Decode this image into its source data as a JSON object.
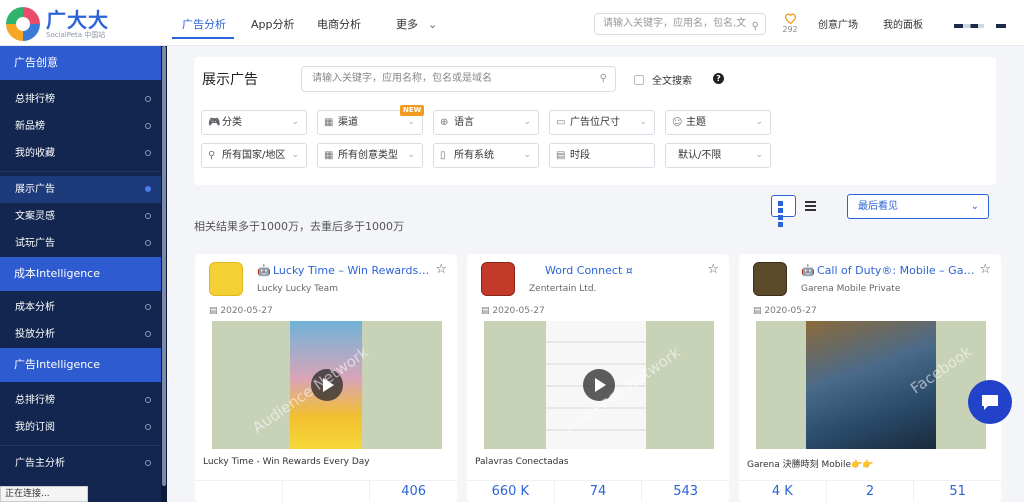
{
  "brand": {
    "name": "广大大",
    "sub": "SocialPeta 中国站"
  },
  "topnav": {
    "tabs": [
      "广告分析",
      "App分析",
      "电商分析",
      "更多"
    ],
    "active": 0
  },
  "top_search": {
    "placeholder": "请输入关键字，应用名，包名,文"
  },
  "favorites": {
    "count": "292"
  },
  "right_links": [
    "创意广场",
    "我的面板"
  ],
  "sidebar": {
    "sections": [
      {
        "title": "广告创意",
        "items": [
          {
            "label": "总排行榜"
          },
          {
            "label": "新品榜"
          },
          {
            "label": "我的收藏"
          },
          {
            "label": "展示广告",
            "active": true
          },
          {
            "label": "文案灵感"
          },
          {
            "label": "试玩广告"
          }
        ]
      },
      {
        "title": "成本Intelligence",
        "items": [
          {
            "label": "成本分析"
          },
          {
            "label": "投放分析"
          }
        ]
      },
      {
        "title": "广告Intelligence",
        "items": [
          {
            "label": "总排行榜"
          },
          {
            "label": "我的订阅"
          },
          {
            "label": "广告主分析"
          }
        ]
      }
    ]
  },
  "panel": {
    "title": "展示广告",
    "search_placeholder": "请输入关键字，应用名称，包名或是域名",
    "fulltext_label": "全文搜索",
    "help": "?",
    "filters_row1": [
      {
        "label": "分类",
        "icon": "gamepad-icon"
      },
      {
        "label": "渠道",
        "icon": "grid-icon",
        "badge": "NEW"
      },
      {
        "label": "语言",
        "icon": "globe-icon"
      },
      {
        "label": "广告位尺寸",
        "icon": "screen-icon"
      },
      {
        "label": "主题",
        "icon": "theme-icon"
      }
    ],
    "filters_row2": [
      {
        "label": "所有国家/地区",
        "icon": "location-icon"
      },
      {
        "label": "所有创意类型",
        "icon": "grid-icon"
      },
      {
        "label": "所有系统",
        "icon": "phone-icon"
      },
      {
        "label": "时段",
        "icon": "calendar-icon"
      },
      {
        "label": "默认/不限",
        "icon": ""
      }
    ]
  },
  "results": {
    "summary": "相关结果多于1000万，去重后多于1000万",
    "sort_label": "最后看见"
  },
  "cards": [
    {
      "platform": "android",
      "app_name": "Lucky Time – Win Rewards ...",
      "developer": "Lucky Lucky Team",
      "date": "2020-05-27",
      "caption": "Lucky Time - Win Rewards Every Day",
      "watermark": "Audience Network",
      "stats": [
        "",
        "",
        "406"
      ],
      "icon_color": "#f3d033"
    },
    {
      "platform": "apple",
      "app_name": "Word Connect ¤",
      "developer": "Zentertain Ltd.",
      "date": "2020-05-27",
      "caption": "Palavras Conectadas",
      "watermark": "Audience Network",
      "stats": [
        "660 K",
        "74",
        "543"
      ],
      "icon_color": "#c43a2a"
    },
    {
      "platform": "android",
      "app_name": "Call of Duty®: Mobile – Gare...",
      "developer": "Garena Mobile Private",
      "date": "2020-05-27",
      "caption": "Garena 決勝時刻 Mobile👉👉",
      "watermark": "Facebook",
      "stats": [
        "4 K",
        "2",
        "51"
      ],
      "icon_color": "#5a4a2a"
    }
  ],
  "status_bar": "正在连接...",
  "colors": {
    "accent": "#2c64d8",
    "sidebar": "#12264f",
    "section": "#2f5bd0"
  }
}
